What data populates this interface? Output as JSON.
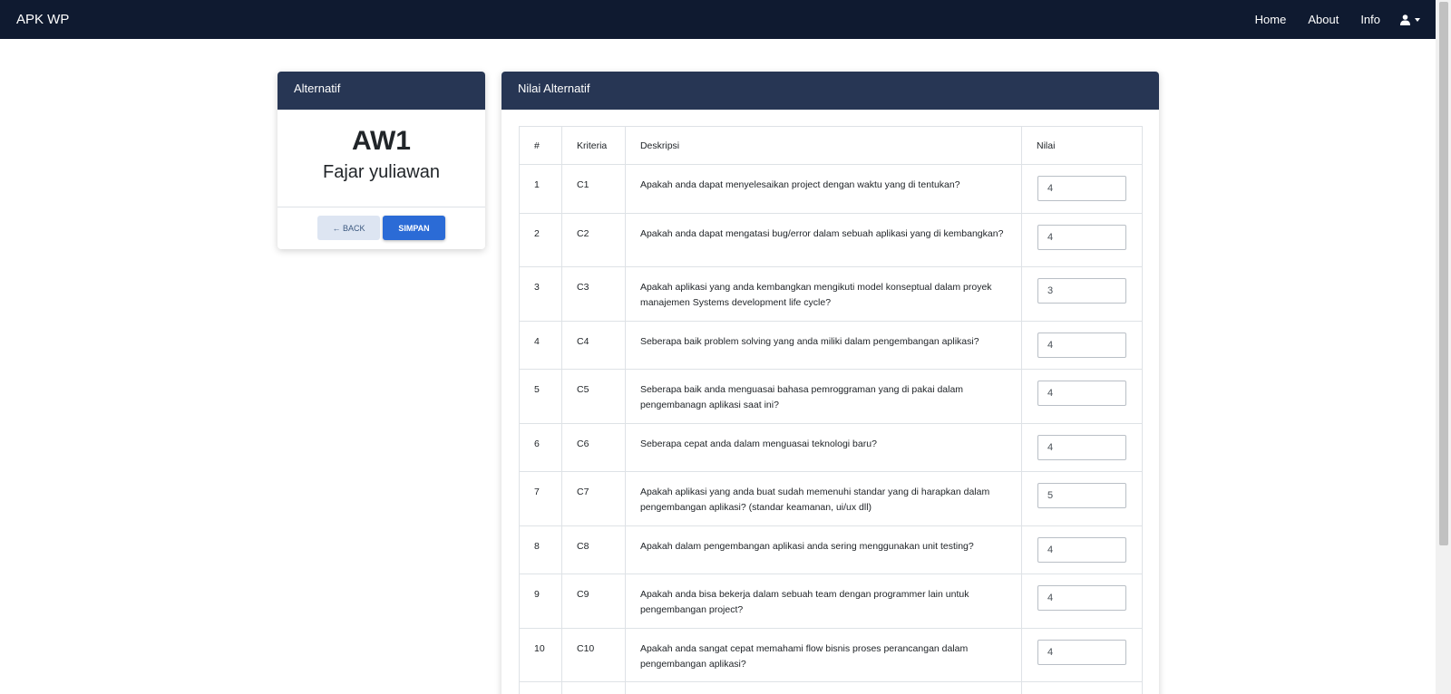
{
  "navbar": {
    "brand": "APK WP",
    "links": [
      "Home",
      "About",
      "Info"
    ],
    "user_icon": "user-icon"
  },
  "alternatif": {
    "header": "Alternatif",
    "code": "AW1",
    "name": "Fajar yuliawan",
    "back_label": "← BACK",
    "save_label": "SIMPAN"
  },
  "nilai": {
    "header": "Nilai Alternatif",
    "columns": [
      "#",
      "Kriteria",
      "Deskripsi",
      "Nilai"
    ],
    "rows": [
      {
        "no": "1",
        "kriteria": "C1",
        "deskripsi": "Apakah anda dapat menyelesaikan project dengan waktu yang di tentukan?",
        "nilai": "4"
      },
      {
        "no": "2",
        "kriteria": "C2",
        "deskripsi": "Apakah anda dapat mengatasi bug/error dalam sebuah aplikasi yang di kembangkan?",
        "nilai": "4"
      },
      {
        "no": "3",
        "kriteria": "C3",
        "deskripsi": "Apakah aplikasi yang anda kembangkan mengikuti model konseptual dalam proyek manajemen Systems development life cycle?",
        "nilai": "3"
      },
      {
        "no": "4",
        "kriteria": "C4",
        "deskripsi": "Seberapa baik problem solving yang anda miliki dalam pengembangan aplikasi?",
        "nilai": "4"
      },
      {
        "no": "5",
        "kriteria": "C5",
        "deskripsi": "Seberapa baik anda menguasai bahasa pemroggraman yang di pakai dalam pengembanagn aplikasi saat ini?",
        "nilai": "4"
      },
      {
        "no": "6",
        "kriteria": "C6",
        "deskripsi": "Seberapa cepat anda dalam menguasai teknologi baru?",
        "nilai": "4"
      },
      {
        "no": "7",
        "kriteria": "C7",
        "deskripsi": "Apakah aplikasi yang anda buat sudah memenuhi standar yang di harapkan dalam pengembangan aplikasi? (standar keamanan, ui/ux dll)",
        "nilai": "5"
      },
      {
        "no": "8",
        "kriteria": "C8",
        "deskripsi": "Apakah dalam pengembangan aplikasi anda sering menggunakan unit testing?",
        "nilai": "4"
      },
      {
        "no": "9",
        "kriteria": "C9",
        "deskripsi": "Apakah anda bisa bekerja dalam sebuah team dengan programmer lain untuk pengembangan project?",
        "nilai": "4"
      },
      {
        "no": "10",
        "kriteria": "C10",
        "deskripsi": "Apakah anda sangat cepat memahami flow bisnis proses perancangan dalam pengembangan aplikasi?",
        "nilai": "4"
      }
    ]
  }
}
